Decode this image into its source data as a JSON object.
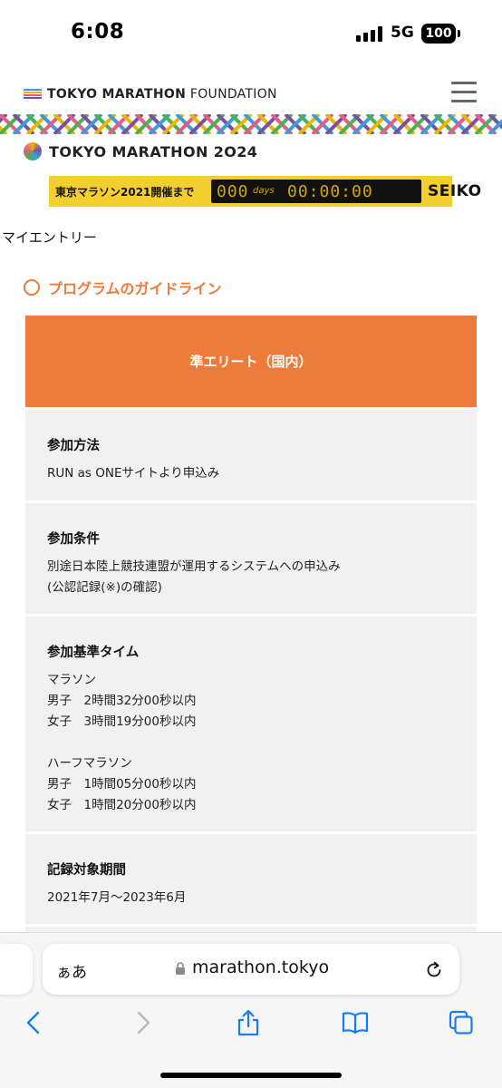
{
  "status_bar": {
    "time": "6:08",
    "network": "5G",
    "battery": "100"
  },
  "header": {
    "foundation_bold": "TOKYO MARATHON",
    "foundation_rest": " FOUNDATION",
    "event_title": "TOKYO MARATHON 2O24",
    "logo_colors": [
      "#3a9dd8",
      "#e8b800",
      "#e85a8a",
      "#7a4fa1",
      "#4caf50"
    ]
  },
  "countdown": {
    "label": "東京マラソン2021開催まで",
    "days_value": "000",
    "days_unit": "days",
    "time_value": "00:00:00",
    "brand": "SEIKO"
  },
  "breadcrumb": "マイエントリー",
  "section_title": "プログラムのガイドライン",
  "table": {
    "header": "準エリート（国内）",
    "rows": [
      {
        "title": "参加方法",
        "lines": [
          "RUN as ONEサイトより申込み"
        ]
      },
      {
        "title": "参加条件",
        "lines": [
          "別途日本陸上競技連盟が運用するシステムへの申込み",
          "(公認記録(※)の確認)"
        ]
      },
      {
        "title": "参加基準タイム",
        "lines": [
          "マラソン",
          "男子　2時間32分00秒以内",
          "女子　3時間19分00秒以内",
          "",
          "ハーフマラソン",
          "男子　1時間05分00秒以内",
          "女子　1時間20分00秒以内"
        ]
      },
      {
        "title": "記録対象期間",
        "lines": [
          "2021年7月～2023年6月"
        ]
      }
    ]
  },
  "browser": {
    "aa_label": "ぁあ",
    "url": "marathon.tokyo"
  },
  "colors": {
    "accent": "#ed7b3c",
    "countdown_bg": "#f2cf2f",
    "ios_blue": "#1a7cf0"
  }
}
